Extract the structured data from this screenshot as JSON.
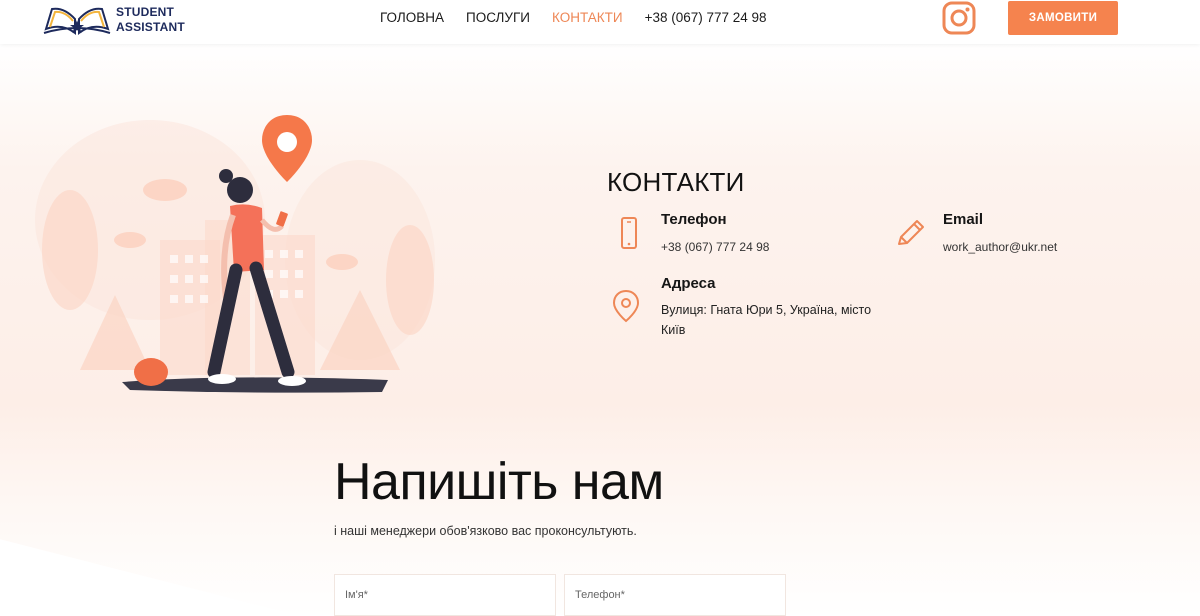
{
  "brand": {
    "line1": "STUDENT",
    "line2": "ASSISTANT"
  },
  "nav": {
    "items": [
      "ГОЛОВНА",
      "ПОСЛУГИ",
      "КОНТАКТИ"
    ],
    "phone": "+38 (067) 777 24 98"
  },
  "header": {
    "order_label": "ЗАМОВИТИ",
    "instagram_icon": "instagram-icon"
  },
  "colors": {
    "accent": "#f5834e",
    "active_nav": "#ee8756",
    "dark_text": "#121212"
  },
  "contacts": {
    "title": "КОНТАКТИ",
    "phone_label": "Телефон",
    "phone_value": "+38 (067) 777 24 98",
    "email_label": "Email",
    "email_value": "work_author@ukr.net",
    "address_label": "Адреса",
    "address_line1": "Вулиця: Гната Юри 5, Україна, місто",
    "address_line2": "Київ"
  },
  "form": {
    "title": "Напишіть нам",
    "subtitle": "і наші менеджери обов'язково вас проконсультують.",
    "name_placeholder": "Ім'я*",
    "phone_placeholder": "Телефон*"
  }
}
